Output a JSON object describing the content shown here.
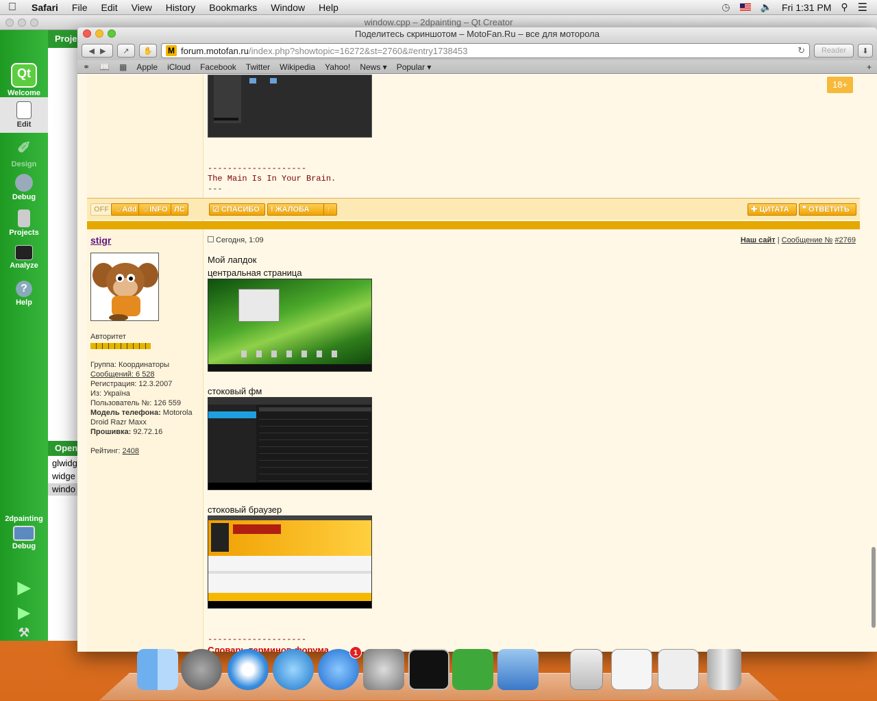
{
  "menubar": {
    "app": "Safari",
    "items": [
      "File",
      "Edit",
      "View",
      "History",
      "Bookmarks",
      "Window",
      "Help"
    ],
    "clock": "Fri 1:31 PM"
  },
  "qt": {
    "title": "window.cpp – 2dpainting – Qt Creator",
    "modes": [
      "Welcome",
      "Edit",
      "Design",
      "Debug",
      "Projects",
      "Analyze",
      "Help"
    ],
    "welcome_glyph": "Qt",
    "projects_header": "Proje",
    "open_header": "Open",
    "open_files": [
      "glwidg",
      "widge",
      "windo"
    ],
    "target_project": "2dpainting",
    "target_mode": "Debug"
  },
  "safari": {
    "title": "Поделитесь скриншотом – MotoFan.Ru – все для моторола",
    "url_host": "forum.motofan.ru",
    "url_path": "/index.php?showtopic=16272&st=2760&#entry1738453",
    "reader": "Reader",
    "bookmarks": [
      "Apple",
      "iCloud",
      "Facebook",
      "Twitter",
      "Wikipedia",
      "Yahoo!",
      "News ▾",
      "Popular ▾"
    ]
  },
  "page": {
    "age_badge": "18+",
    "prev_post": {
      "sig_dashes": "--------------------",
      "sig_text": "The Main Is In Your Brain.",
      "sig_end": "---"
    },
    "actions_left": [
      "OFF",
      "Add",
      "INFO",
      "ЛС"
    ],
    "actions_mid": [
      "СПАСИБО",
      "ЖАЛОБА",
      "↑"
    ],
    "actions_right": [
      "ЦИТАТА",
      "ОТВЕТИТЬ"
    ],
    "post": {
      "username": "stigr",
      "date": "Сегодня, 1:09",
      "our_site": "Наш сайт",
      "msg_label": "Сообщение №",
      "msg_num": "#2769",
      "rank": "Авторитет",
      "group_label": "Группа:",
      "group": "Координаторы",
      "msgs_label": "Сообщений:",
      "msgs": "6 528",
      "reg_label": "Регистрация:",
      "reg": "12.3.2007",
      "from_label": "Из:",
      "from": "Україна",
      "user_no_label": "Пользователь №:",
      "user_no": "126 559",
      "model_label": "Модель телефона:",
      "model": "Motorola Droid Razr Maxx",
      "fw_label": "Прошивка:",
      "fw": "92.72.16",
      "rating_label": "Рейтинг:",
      "rating": "2408",
      "lines": [
        "Мой лапдок",
        "центральная страница",
        "стоковый фм",
        "стоковый браузер"
      ],
      "sig_dashes": "--------------------",
      "sig_text": "Словарь терминов форума"
    }
  },
  "dock": {
    "apps": [
      "finder-icon",
      "launchpad-icon",
      "safari-icon",
      "itunes-icon",
      "app-store-icon",
      "system-preferences-icon",
      "terminal-icon",
      "qt-creator-icon",
      "xcode-icon",
      "disk-utility-icon",
      "preview-icon",
      "finder-window-icon",
      "trash-icon"
    ],
    "app_store_badge": "1"
  }
}
